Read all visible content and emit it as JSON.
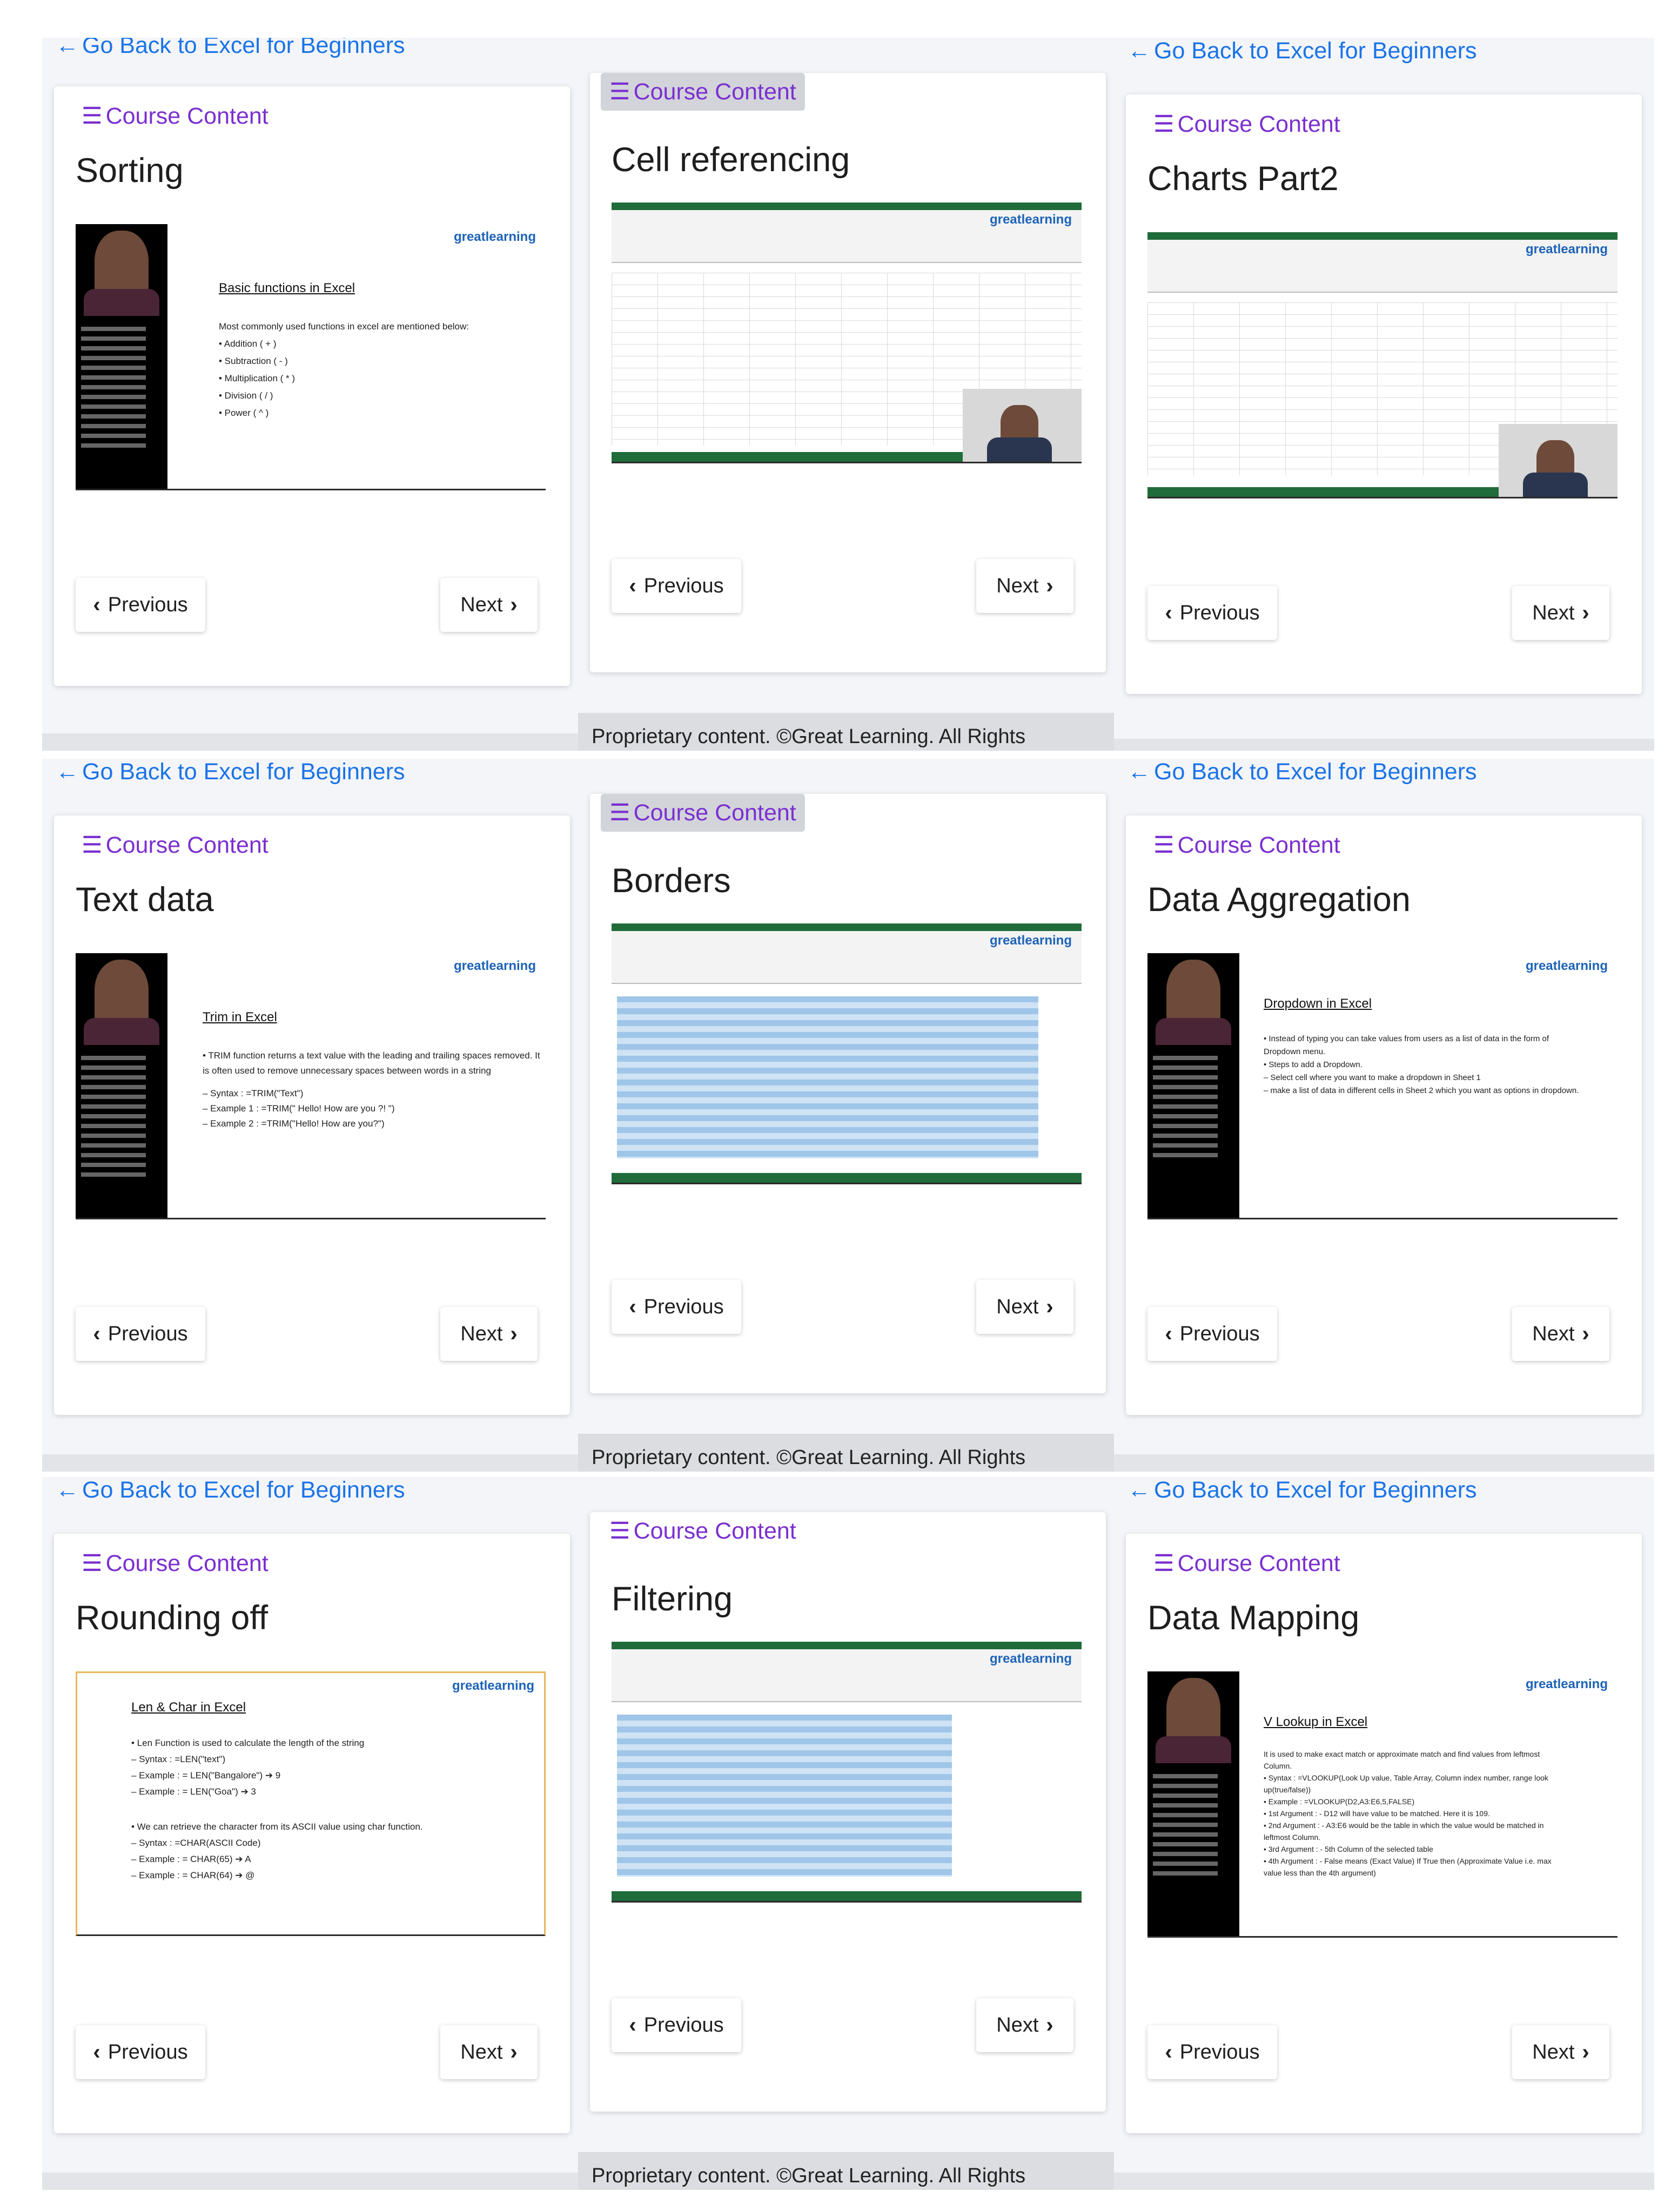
{
  "common": {
    "back_link": "Go Back to Excel for Beginners",
    "course_content": "Course Content",
    "previous": "Previous",
    "next": "Next",
    "footer": "Proprietary content. ©Great Learning. All Rights"
  },
  "panels": [
    {
      "title": "Sorting",
      "slide": {
        "logo": "greatlearning",
        "heading": "Basic functions in Excel",
        "lines": [
          "Most commonly used functions in excel are mentioned below:",
          "• Addition ( + )",
          "• Subtraction ( - )",
          "• Multiplication ( * )",
          "• Division ( / )",
          "• Power ( ^ )"
        ]
      }
    },
    {
      "title": "Cell referencing",
      "slide": {
        "logo": "greatlearning"
      }
    },
    {
      "title": "Charts Part2",
      "slide": {
        "logo": "greatlearning"
      }
    },
    {
      "title": "Text data",
      "slide": {
        "logo": "greatlearning",
        "heading": "Trim in Excel",
        "lines": [
          "• TRIM function returns a text value with the leading and trailing spaces removed. It",
          "  is often used to remove unnecessary spaces between words in a string",
          "– Syntax : =TRIM(\"Text\")",
          "– Example 1 : =TRIM(\" Hello! How are you ?! \")",
          "– Example 2 : =TRIM(\"Hello!   How   are you?\")"
        ]
      }
    },
    {
      "title": "Borders",
      "slide": {
        "logo": "greatlearning"
      }
    },
    {
      "title": "Data Aggregation",
      "slide": {
        "logo": "greatlearning",
        "heading": "Dropdown in Excel",
        "lines": [
          "• Instead of typing you can take values from users as a list of data in the form of",
          "  Dropdown menu.",
          "• Steps to add a Dropdown.",
          "  – Select cell where you want to make a dropdown in Sheet 1",
          "  – make a list of data in different cells in Sheet 2 which you want as options in dropdown."
        ]
      }
    },
    {
      "title": "Rounding off",
      "slide": {
        "logo": "greatlearning",
        "heading": "Len & Char in Excel",
        "lines": [
          "• Len Function is used to calculate the length of the string",
          "  – Syntax : =LEN(\"text\")",
          "  – Example : = LEN(\"Bangalore\") ➔ 9",
          "  – Example : = LEN(\"Goa\") ➔ 3",
          "• We can retrieve the character from its ASCII value using char function.",
          "  – Syntax : =CHAR(ASCII Code)",
          "  – Example : = CHAR(65) ➔ A",
          "  – Example : = CHAR(64) ➔ @"
        ]
      }
    },
    {
      "title": "Filtering",
      "slide": {
        "logo": "greatlearning"
      }
    },
    {
      "title": "Data Mapping",
      "slide": {
        "logo": "greatlearning",
        "heading": "V Lookup in Excel",
        "lines": [
          "It is used to make exact match or approximate match and find values from leftmost",
          "Column.",
          "• Syntax : =VLOOKUP(Look Up value, Table Array, Column index number, range look",
          "  up(true/false))",
          "• Example : =VLOOKUP(D2,A3:E6,5,FALSE)",
          "• 1st Argument : - D12 will have value to be matched. Here it is 109.",
          "• 2nd Argument : - A3:E6 would be the table in which the value would be matched in",
          "  leftmost Column.",
          "• 3rd Argument : - 5th Column of the selected table",
          "• 4th Argument : - False means (Exact Value) If True then (Approximate Value i.e. max",
          "  value less than the 4th argument)"
        ]
      }
    }
  ]
}
